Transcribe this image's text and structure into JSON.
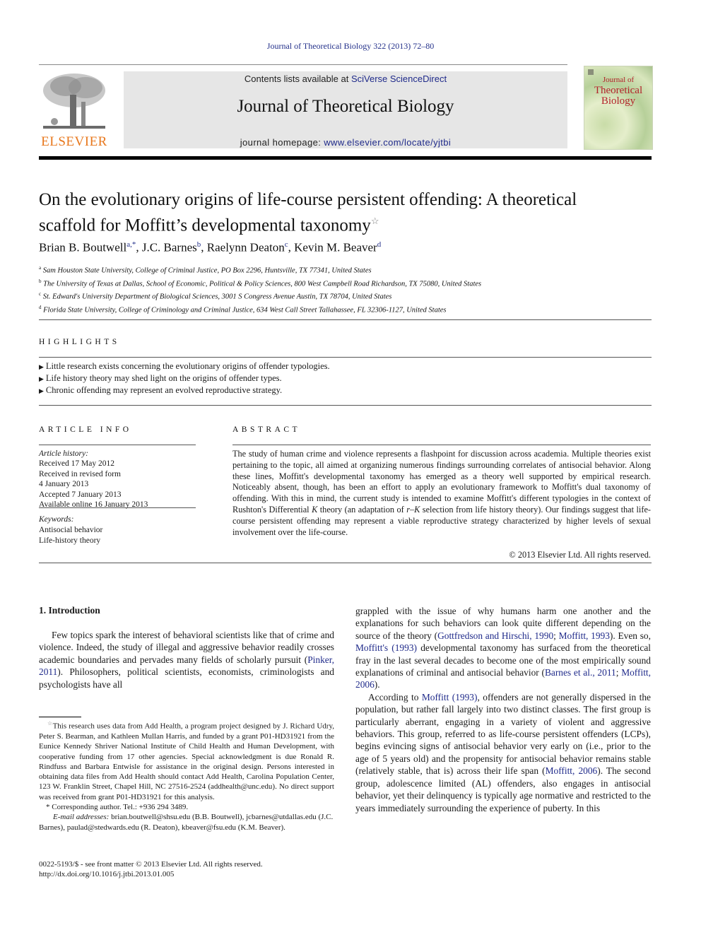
{
  "citation": "Journal of Theoretical Biology 322 (2013) 72–80",
  "masthead": {
    "contents_prefix": "Contents lists available at ",
    "contents_link": "SciVerse ScienceDirect",
    "journal_name": "Journal of Theoretical Biology",
    "homepage_prefix": "journal homepage: ",
    "homepage_link": "www.elsevier.com/locate/yjtbi",
    "publisher_logo": "ELSEVIER",
    "cover_title_line1": "Journal of",
    "cover_title_line2": "Theoretical",
    "cover_title_line3": "Biology"
  },
  "colors": {
    "link": "#1f2a8a",
    "elsevier_orange": "#e8781e",
    "cover_red": "#b3222a",
    "masthead_bg": "#e6e6e6"
  },
  "article": {
    "title_line1": "On the evolutionary origins of life-course persistent offending: A theoretical",
    "title_line2": "scaffold for Moffitt’s developmental taxonomy",
    "title_note_mark": "☆",
    "authors": [
      {
        "name": "Brian B. Boutwell",
        "sup": "a,*"
      },
      {
        "name": "J.C. Barnes",
        "sup": "b"
      },
      {
        "name": "Raelynn Deaton",
        "sup": "c"
      },
      {
        "name": "Kevin M. Beaver",
        "sup": "d"
      }
    ],
    "affiliations": [
      {
        "mark": "a",
        "text": "Sam Houston State University, College of Criminal Justice, PO Box 2296, Huntsville, TX 77341, United States"
      },
      {
        "mark": "b",
        "text": "The University of Texas at Dallas, School of Economic, Political & Policy Sciences, 800 West Campbell Road Richardson, TX 75080, United States"
      },
      {
        "mark": "c",
        "text": "St. Edward's University Department of Biological Sciences, 3001 S Congress Avenue Austin, TX 78704, United States"
      },
      {
        "mark": "d",
        "text": "Florida State University, College of Criminology and Criminal Justice, 634 West Call Street Tallahassee, FL 32306-1127, United States"
      }
    ]
  },
  "highlights": {
    "heading": "HIGHLIGHTS",
    "bullet": "▶",
    "items": [
      "Little research exists concerning the evolutionary origins of offender typologies.",
      "Life history theory may shed light on the origins of offender types.",
      "Chronic offending may represent an evolved reproductive strategy."
    ]
  },
  "article_info": {
    "heading": "ARTICLE INFO",
    "history_label": "Article history:",
    "history": [
      "Received 17 May 2012",
      "Received in revised form",
      "4 January 2013",
      "Accepted 7 January 2013",
      "Available online 16 January 2013"
    ],
    "keywords_label": "Keywords:",
    "keywords": [
      "Antisocial behavior",
      "Life-history theory"
    ]
  },
  "abstract": {
    "heading": "ABSTRACT",
    "text_part1": "The study of human crime and violence represents a flashpoint for discussion across academia. Multiple theories exist pertaining to the topic, all aimed at organizing numerous findings surrounding correlates of antisocial behavior. Along these lines, Moffitt's developmental taxonomy has emerged as a theory well supported by empirical research. Noticeably absent, though, has been an effort to apply an evolutionary framework to Moffitt's dual taxonomy of offending. With this in mind, the current study is intended to examine Moffitt's different typologies in the context of Rushton's Differential ",
    "k_italic": "K",
    "text_part2": " theory (an adaptation of ",
    "rk_italic": "r–K",
    "text_part3": " selection from life history theory). Our findings suggest that life-course persistent offending may represent a viable reproductive strategy characterized by higher levels of sexual involvement over the life-course.",
    "copyright": "© 2013 Elsevier Ltd. All rights reserved."
  },
  "body": {
    "section_heading": "1.  Introduction",
    "left_p1_a": "Few topics spark the interest of behavioral scientists like that of crime and violence. Indeed, the study of illegal and aggressive behavior readily crosses academic boundaries and pervades many fields of scholarly pursuit (",
    "left_p1_link1": "Pinker, 2011",
    "left_p1_b": "). Philosophers, political scientists, economists, criminologists and psychologists have all",
    "right_p1_a": "grappled with the issue of why humans harm one another and the explanations for such behaviors can look quite different depending on the source of the theory (",
    "right_p1_link1": "Gottfredson and Hirschi, 1990",
    "right_p1_sep1": "; ",
    "right_p1_link2": "Moffitt, 1993",
    "right_p1_b": "). Even so, ",
    "right_p1_link3": "Moffitt's (1993)",
    "right_p1_c": " developmental taxonomy has surfaced from the theoretical fray in the last several decades to become one of the most empirically sound explanations of criminal and antisocial behavior (",
    "right_p1_link4": "Barnes et al., 2011",
    "right_p1_sep2": "; ",
    "right_p1_link5": "Moffitt, 2006",
    "right_p1_d": ").",
    "right_p2_a": "According to ",
    "right_p2_link1": "Moffitt (1993)",
    "right_p2_b": ", offenders are not generally dispersed in the population, but rather fall largely into two distinct classes. The first group is particularly aberrant, engaging in a variety of violent and aggressive behaviors. This group, referred to as life-course persistent offenders (LCPs), begins evincing signs of antisocial behavior very early on (i.e., prior to the age of 5 years old) and the propensity for antisocial behavior remains stable (relatively stable, that is) across their life span (",
    "right_p2_link2": "Moffitt, 2006",
    "right_p2_c": "). The second group, adolescence limited (AL) offenders, also engages in antisocial behavior, yet their delinquency is typically age normative and restricted to the years immediately surrounding the experience of puberty. In this"
  },
  "footnotes": {
    "star_mark": "☆",
    "funding_note": "This research uses data from Add Health, a program project designed by J. Richard Udry, Peter S. Bearman, and Kathleen Mullan Harris, and funded by a grant P01-HD31921 from the Eunice Kennedy Shriver National Institute of Child Health and Human Development, with cooperative funding from 17 other agencies. Special acknowledgment is due Ronald R. Rindfuss and Barbara Entwisle for assistance in the original design. Persons interested in obtaining data files from Add Health should contact Add Health, Carolina Population Center, 123 W. Franklin Street, Chapel Hill, NC 27516-2524 (addhealth@unc.edu). No direct support was received from grant P01-HD31921 for this analysis.",
    "corresponding_mark": "*",
    "corresponding": "Corresponding author. Tel.: +936 294 3489.",
    "email_label": "E-mail addresses:",
    "emails": "brian.boutwell@shsu.edu (B.B. Boutwell), jcbarnes@utdallas.edu (J.C. Barnes), paulad@stedwards.edu (R. Deaton), kbeaver@fsu.edu (K.M. Beaver).",
    "front_matter": "0022-5193/$ - see front matter © 2013 Elsevier Ltd. All rights reserved.",
    "doi": "http://dx.doi.org/10.1016/j.jtbi.2013.01.005"
  }
}
